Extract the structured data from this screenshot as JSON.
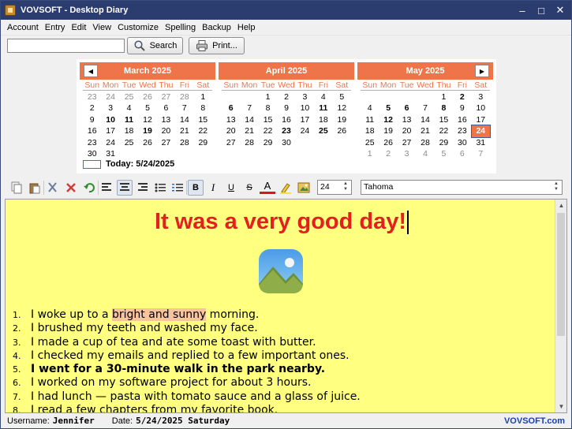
{
  "window": {
    "title": "VOVSOFT - Desktop Diary"
  },
  "menu": [
    "Account",
    "Entry",
    "Edit",
    "View",
    "Customize",
    "Spelling",
    "Backup",
    "Help"
  ],
  "search": {
    "value": "",
    "button": "Search",
    "print": "Print..."
  },
  "calendar": {
    "dow": [
      "Sun",
      "Mon",
      "Tue",
      "Wed",
      "Thu",
      "Fri",
      "Sat"
    ],
    "today_label": "Today: 5/24/2025",
    "months": [
      {
        "name": "March 2025",
        "days": [
          [
            "23",
            "g"
          ],
          [
            "24",
            "g"
          ],
          [
            "25",
            "g"
          ],
          [
            "26",
            "g"
          ],
          [
            "27",
            "g"
          ],
          [
            "28",
            "g"
          ],
          [
            "1",
            ""
          ],
          [
            "2",
            ""
          ],
          [
            "3",
            ""
          ],
          [
            "4",
            ""
          ],
          [
            "5",
            ""
          ],
          [
            "6",
            ""
          ],
          [
            "7",
            ""
          ],
          [
            "8",
            ""
          ],
          [
            "9",
            ""
          ],
          [
            "10",
            "b"
          ],
          [
            "11",
            "b"
          ],
          [
            "12",
            ""
          ],
          [
            "13",
            ""
          ],
          [
            "14",
            ""
          ],
          [
            "15",
            ""
          ],
          [
            "16",
            ""
          ],
          [
            "17",
            ""
          ],
          [
            "18",
            ""
          ],
          [
            "19",
            "b"
          ],
          [
            "20",
            ""
          ],
          [
            "21",
            ""
          ],
          [
            "22",
            ""
          ],
          [
            "23",
            ""
          ],
          [
            "24",
            ""
          ],
          [
            "25",
            ""
          ],
          [
            "26",
            ""
          ],
          [
            "27",
            ""
          ],
          [
            "28",
            ""
          ],
          [
            "29",
            ""
          ],
          [
            "30",
            ""
          ],
          [
            "31",
            ""
          ]
        ]
      },
      {
        "name": "April 2025",
        "days": [
          [
            "",
            ""
          ],
          [
            "",
            ""
          ],
          [
            "1",
            ""
          ],
          [
            "2",
            ""
          ],
          [
            "3",
            ""
          ],
          [
            "4",
            ""
          ],
          [
            "5",
            ""
          ],
          [
            "6",
            "b"
          ],
          [
            "7",
            ""
          ],
          [
            "8",
            ""
          ],
          [
            "9",
            ""
          ],
          [
            "10",
            ""
          ],
          [
            "11",
            "b"
          ],
          [
            "12",
            ""
          ],
          [
            "13",
            ""
          ],
          [
            "14",
            ""
          ],
          [
            "15",
            ""
          ],
          [
            "16",
            ""
          ],
          [
            "17",
            ""
          ],
          [
            "18",
            ""
          ],
          [
            "19",
            ""
          ],
          [
            "20",
            ""
          ],
          [
            "21",
            ""
          ],
          [
            "22",
            ""
          ],
          [
            "23",
            "b"
          ],
          [
            "24",
            ""
          ],
          [
            "25",
            "b"
          ],
          [
            "26",
            ""
          ],
          [
            "27",
            ""
          ],
          [
            "28",
            ""
          ],
          [
            "29",
            ""
          ],
          [
            "30",
            ""
          ]
        ]
      },
      {
        "name": "May 2025",
        "days": [
          [
            "",
            ""
          ],
          [
            "",
            ""
          ],
          [
            "",
            ""
          ],
          [
            "",
            ""
          ],
          [
            "1",
            ""
          ],
          [
            "2",
            "b"
          ],
          [
            "3",
            ""
          ],
          [
            "4",
            ""
          ],
          [
            "5",
            "b"
          ],
          [
            "6",
            "b"
          ],
          [
            "7",
            ""
          ],
          [
            "8",
            "b"
          ],
          [
            "9",
            ""
          ],
          [
            "10",
            ""
          ],
          [
            "11",
            ""
          ],
          [
            "12",
            "b"
          ],
          [
            "13",
            ""
          ],
          [
            "14",
            ""
          ],
          [
            "15",
            ""
          ],
          [
            "16",
            ""
          ],
          [
            "17",
            ""
          ],
          [
            "18",
            ""
          ],
          [
            "19",
            ""
          ],
          [
            "20",
            ""
          ],
          [
            "21",
            ""
          ],
          [
            "22",
            ""
          ],
          [
            "23",
            ""
          ],
          [
            "24",
            "sel"
          ],
          [
            "25",
            ""
          ],
          [
            "26",
            ""
          ],
          [
            "27",
            ""
          ],
          [
            "28",
            ""
          ],
          [
            "29",
            ""
          ],
          [
            "30",
            ""
          ],
          [
            "31",
            ""
          ],
          [
            "1",
            "g"
          ],
          [
            "2",
            "g"
          ],
          [
            "3",
            "g"
          ],
          [
            "4",
            "g"
          ],
          [
            "5",
            "g"
          ],
          [
            "6",
            "g"
          ],
          [
            "7",
            "g"
          ]
        ]
      }
    ]
  },
  "toolbar": {
    "font_size": "24",
    "font_name": "Tahoma"
  },
  "entry": {
    "heading": "It was a very good day!",
    "items": [
      {
        "n": "1.",
        "pre": "I woke up to a ",
        "hl": "bright and sunny",
        "post": " morning.",
        "bold": false
      },
      {
        "n": "2.",
        "pre": "I brushed my teeth and washed my face.",
        "hl": "",
        "post": "",
        "bold": false
      },
      {
        "n": "3.",
        "pre": "I made a cup of tea and ate some toast with butter.",
        "hl": "",
        "post": "",
        "bold": false
      },
      {
        "n": "4.",
        "pre": "I checked my emails and replied to a few important ones.",
        "hl": "",
        "post": "",
        "bold": false
      },
      {
        "n": "5.",
        "pre": "I went for a 30-minute walk in the park nearby.",
        "hl": "",
        "post": "",
        "bold": true
      },
      {
        "n": "6.",
        "pre": "I worked on my software project for about 3 hours.",
        "hl": "",
        "post": "",
        "bold": false
      },
      {
        "n": "7.",
        "pre": "I had lunch — pasta with tomato sauce and a glass of juice.",
        "hl": "",
        "post": "",
        "bold": false
      },
      {
        "n": "8.",
        "pre": "I read a few chapters from my favorite book.",
        "hl": "",
        "post": "",
        "bold": false
      }
    ]
  },
  "status": {
    "username_label": "Username:",
    "username": "Jennifer",
    "date_label": "Date:",
    "date": "5/24/2025 Saturday",
    "brand": "VOVSOFT.com"
  }
}
